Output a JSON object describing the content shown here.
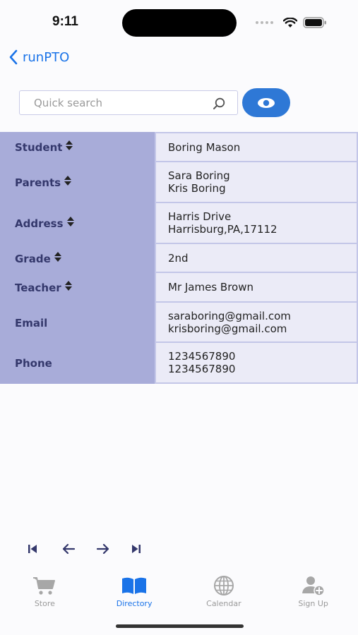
{
  "status": {
    "time": "9:11"
  },
  "nav": {
    "back_label": "runPTO"
  },
  "search": {
    "placeholder": "Quick search",
    "value": ""
  },
  "record": {
    "rows": [
      {
        "label": "Student",
        "sortable": true,
        "values": [
          "Boring Mason"
        ]
      },
      {
        "label": "Parents",
        "sortable": true,
        "values": [
          "Sara Boring",
          "Kris Boring"
        ]
      },
      {
        "label": "Address",
        "sortable": true,
        "values": [
          "Harris Drive",
          "Harrisburg,PA,17112"
        ]
      },
      {
        "label": "Grade",
        "sortable": true,
        "values": [
          "2nd"
        ]
      },
      {
        "label": "Teacher",
        "sortable": true,
        "values": [
          "Mr James Brown"
        ]
      },
      {
        "label": "Email",
        "sortable": false,
        "values": [
          "saraboring@gmail.com",
          "krisboring@gmail.com"
        ]
      },
      {
        "label": "Phone",
        "sortable": false,
        "values": [
          "1234567890",
          "1234567890"
        ]
      }
    ]
  },
  "tabs": [
    {
      "label": "Store",
      "icon": "cart-icon",
      "active": false
    },
    {
      "label": "Directory",
      "icon": "book-icon",
      "active": true
    },
    {
      "label": "Calendar",
      "icon": "globe-icon",
      "active": false
    },
    {
      "label": "Sign Up",
      "icon": "add-user-icon",
      "active": false
    }
  ],
  "colors": {
    "accent": "#1a73e8",
    "toggle": "#2e78d6",
    "label_bg": "#a8acd9",
    "label_text": "#34386c",
    "value_bg": "#ebebf7"
  }
}
